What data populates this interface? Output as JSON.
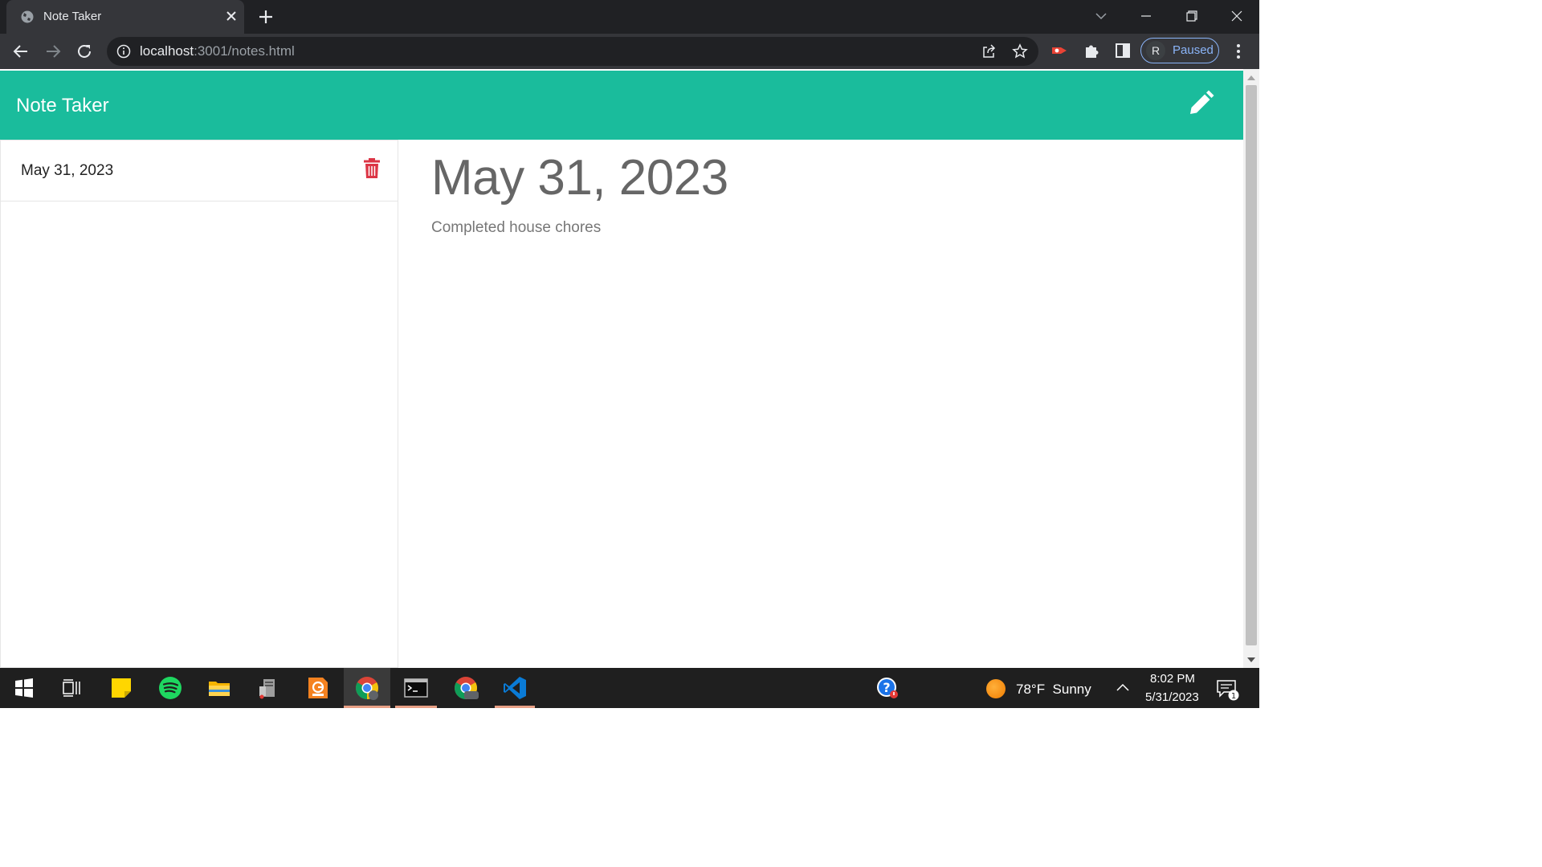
{
  "browser": {
    "tab_title": "Note Taker",
    "url_host": "localhost",
    "url_rest": ":3001/notes.html",
    "profile_initial": "R",
    "profile_status": "Paused"
  },
  "app": {
    "brand": "Note Taker",
    "accent_color": "#1abc9c",
    "delete_color": "#dc3545"
  },
  "notes_list": [
    {
      "title": "May 31, 2023"
    }
  ],
  "active_note": {
    "title": "May 31, 2023",
    "text": "Completed house chores"
  },
  "taskbar": {
    "weather_temp": "78°F",
    "weather_condition": "Sunny",
    "time": "8:02 PM",
    "date": "5/31/2023",
    "notification_count": "1"
  }
}
